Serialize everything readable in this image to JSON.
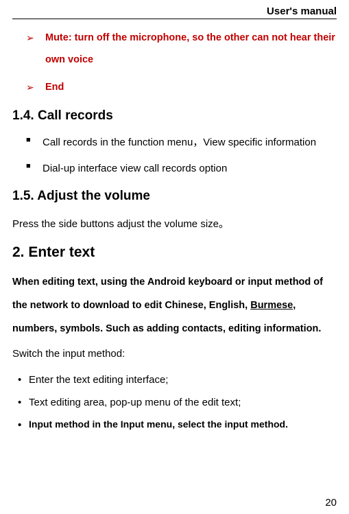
{
  "header": {
    "title": "User's manual"
  },
  "arrows": {
    "item1": "Mute: turn  off  the  microphone,  so the other can  not  hear their  own voice",
    "item2": "End"
  },
  "section14": {
    "heading": "1.4.   Call  records",
    "bullet1": "Call  records in the function  menu，View specific  information",
    "bullet2": "Dial-up interface view call  records option"
  },
  "section15": {
    "heading": "1.5.   Adjust  the  volume",
    "para": "Press  the side  buttons adjust the volume size。"
  },
  "section2": {
    "heading": "2.  Enter  text",
    "intro_before": "When  editing  text,  using  the  Android  keyboard  or  input   method  of  the  network  to  download  to  edit  Chinese,  English,  ",
    "intro_burmese": "Burmese,",
    "intro_after": "  numbers,  symbols.  Such  as  adding  contacts,  editing  information.",
    "switch_label": "Switch  the  input  method:",
    "dot1": "Enter the text editing  interface;",
    "dot2": "Text editing  area,  pop-up menu of the edit  text;",
    "dot3": "Input  method in the Input  menu, select the input  method."
  },
  "page": {
    "number": "20"
  }
}
